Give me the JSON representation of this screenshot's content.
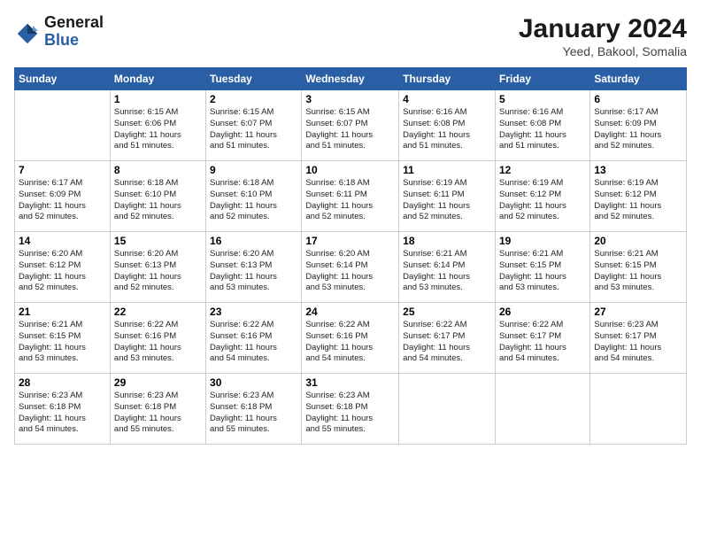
{
  "header": {
    "logo_general": "General",
    "logo_blue": "Blue",
    "month_title": "January 2024",
    "location": "Yeed, Bakool, Somalia"
  },
  "calendar": {
    "days_of_week": [
      "Sunday",
      "Monday",
      "Tuesday",
      "Wednesday",
      "Thursday",
      "Friday",
      "Saturday"
    ],
    "weeks": [
      [
        {
          "day": "",
          "info": ""
        },
        {
          "day": "1",
          "info": "Sunrise: 6:15 AM\nSunset: 6:06 PM\nDaylight: 11 hours\nand 51 minutes."
        },
        {
          "day": "2",
          "info": "Sunrise: 6:15 AM\nSunset: 6:07 PM\nDaylight: 11 hours\nand 51 minutes."
        },
        {
          "day": "3",
          "info": "Sunrise: 6:15 AM\nSunset: 6:07 PM\nDaylight: 11 hours\nand 51 minutes."
        },
        {
          "day": "4",
          "info": "Sunrise: 6:16 AM\nSunset: 6:08 PM\nDaylight: 11 hours\nand 51 minutes."
        },
        {
          "day": "5",
          "info": "Sunrise: 6:16 AM\nSunset: 6:08 PM\nDaylight: 11 hours\nand 51 minutes."
        },
        {
          "day": "6",
          "info": "Sunrise: 6:17 AM\nSunset: 6:09 PM\nDaylight: 11 hours\nand 52 minutes."
        }
      ],
      [
        {
          "day": "7",
          "info": "Sunrise: 6:17 AM\nSunset: 6:09 PM\nDaylight: 11 hours\nand 52 minutes."
        },
        {
          "day": "8",
          "info": "Sunrise: 6:18 AM\nSunset: 6:10 PM\nDaylight: 11 hours\nand 52 minutes."
        },
        {
          "day": "9",
          "info": "Sunrise: 6:18 AM\nSunset: 6:10 PM\nDaylight: 11 hours\nand 52 minutes."
        },
        {
          "day": "10",
          "info": "Sunrise: 6:18 AM\nSunset: 6:11 PM\nDaylight: 11 hours\nand 52 minutes."
        },
        {
          "day": "11",
          "info": "Sunrise: 6:19 AM\nSunset: 6:11 PM\nDaylight: 11 hours\nand 52 minutes."
        },
        {
          "day": "12",
          "info": "Sunrise: 6:19 AM\nSunset: 6:12 PM\nDaylight: 11 hours\nand 52 minutes."
        },
        {
          "day": "13",
          "info": "Sunrise: 6:19 AM\nSunset: 6:12 PM\nDaylight: 11 hours\nand 52 minutes."
        }
      ],
      [
        {
          "day": "14",
          "info": "Sunrise: 6:20 AM\nSunset: 6:12 PM\nDaylight: 11 hours\nand 52 minutes."
        },
        {
          "day": "15",
          "info": "Sunrise: 6:20 AM\nSunset: 6:13 PM\nDaylight: 11 hours\nand 52 minutes."
        },
        {
          "day": "16",
          "info": "Sunrise: 6:20 AM\nSunset: 6:13 PM\nDaylight: 11 hours\nand 53 minutes."
        },
        {
          "day": "17",
          "info": "Sunrise: 6:20 AM\nSunset: 6:14 PM\nDaylight: 11 hours\nand 53 minutes."
        },
        {
          "day": "18",
          "info": "Sunrise: 6:21 AM\nSunset: 6:14 PM\nDaylight: 11 hours\nand 53 minutes."
        },
        {
          "day": "19",
          "info": "Sunrise: 6:21 AM\nSunset: 6:15 PM\nDaylight: 11 hours\nand 53 minutes."
        },
        {
          "day": "20",
          "info": "Sunrise: 6:21 AM\nSunset: 6:15 PM\nDaylight: 11 hours\nand 53 minutes."
        }
      ],
      [
        {
          "day": "21",
          "info": "Sunrise: 6:21 AM\nSunset: 6:15 PM\nDaylight: 11 hours\nand 53 minutes."
        },
        {
          "day": "22",
          "info": "Sunrise: 6:22 AM\nSunset: 6:16 PM\nDaylight: 11 hours\nand 53 minutes."
        },
        {
          "day": "23",
          "info": "Sunrise: 6:22 AM\nSunset: 6:16 PM\nDaylight: 11 hours\nand 54 minutes."
        },
        {
          "day": "24",
          "info": "Sunrise: 6:22 AM\nSunset: 6:16 PM\nDaylight: 11 hours\nand 54 minutes."
        },
        {
          "day": "25",
          "info": "Sunrise: 6:22 AM\nSunset: 6:17 PM\nDaylight: 11 hours\nand 54 minutes."
        },
        {
          "day": "26",
          "info": "Sunrise: 6:22 AM\nSunset: 6:17 PM\nDaylight: 11 hours\nand 54 minutes."
        },
        {
          "day": "27",
          "info": "Sunrise: 6:23 AM\nSunset: 6:17 PM\nDaylight: 11 hours\nand 54 minutes."
        }
      ],
      [
        {
          "day": "28",
          "info": "Sunrise: 6:23 AM\nSunset: 6:18 PM\nDaylight: 11 hours\nand 54 minutes."
        },
        {
          "day": "29",
          "info": "Sunrise: 6:23 AM\nSunset: 6:18 PM\nDaylight: 11 hours\nand 55 minutes."
        },
        {
          "day": "30",
          "info": "Sunrise: 6:23 AM\nSunset: 6:18 PM\nDaylight: 11 hours\nand 55 minutes."
        },
        {
          "day": "31",
          "info": "Sunrise: 6:23 AM\nSunset: 6:18 PM\nDaylight: 11 hours\nand 55 minutes."
        },
        {
          "day": "",
          "info": ""
        },
        {
          "day": "",
          "info": ""
        },
        {
          "day": "",
          "info": ""
        }
      ]
    ]
  }
}
